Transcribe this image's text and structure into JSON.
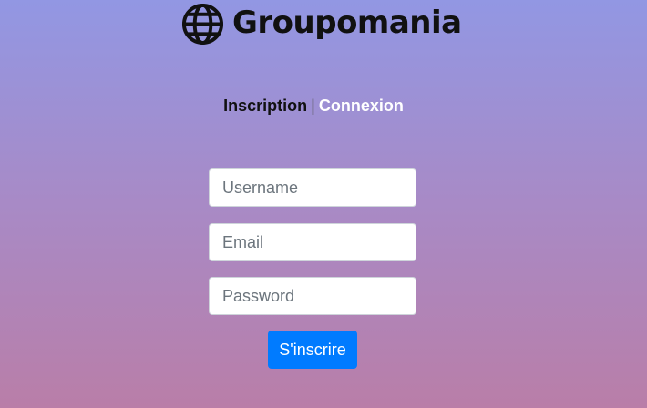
{
  "header": {
    "logo_icon": "globe-icon",
    "brand_name": "Groupomania"
  },
  "nav": {
    "inscription_label": "Inscription",
    "separator": "|",
    "connexion_label": "Connexion"
  },
  "form": {
    "username_placeholder": "Username",
    "email_placeholder": "Email",
    "password_placeholder": "Password",
    "submit_label": "S'inscrire"
  },
  "colors": {
    "gradient_top": "#9297e3",
    "gradient_bottom": "#b97ea8",
    "button_primary": "#007bff",
    "active_link": "#ffffff",
    "inactive_link": "#111111"
  }
}
